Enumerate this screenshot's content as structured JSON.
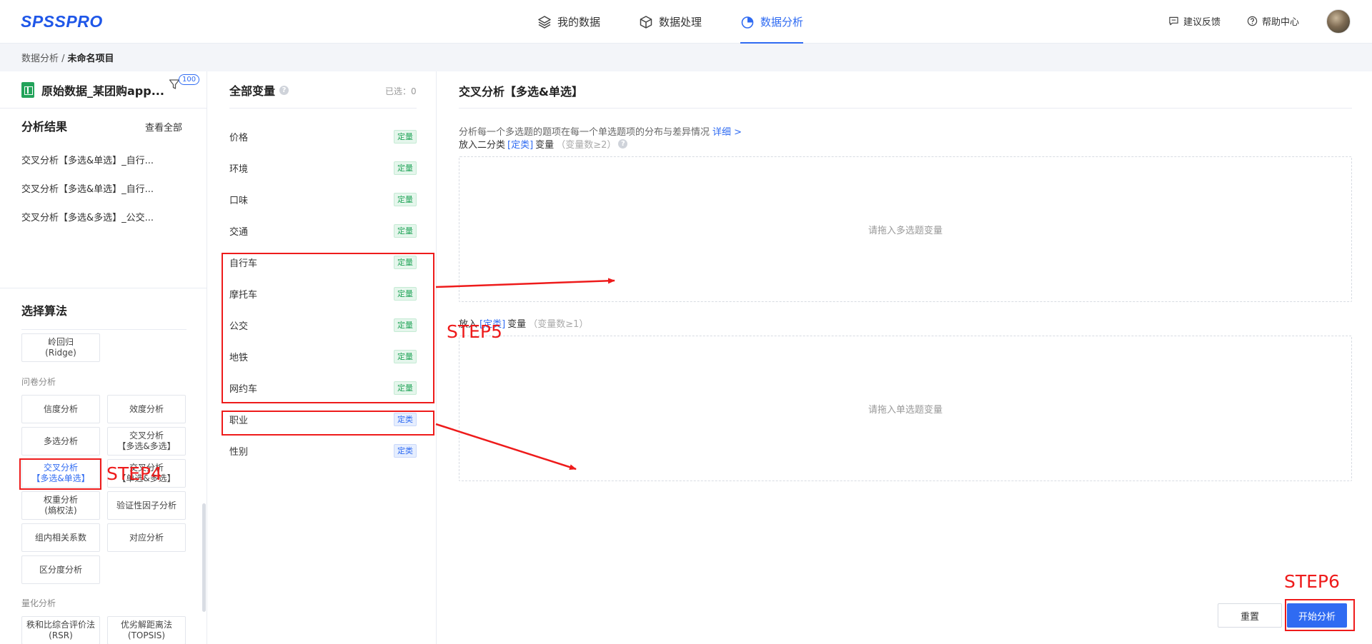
{
  "app": {
    "logo": "SPSSPRO"
  },
  "nav": {
    "tabs": [
      {
        "label": "我的数据",
        "icon": "layers-icon"
      },
      {
        "label": "数据处理",
        "icon": "cube-icon"
      },
      {
        "label": "数据分析",
        "icon": "pie-chart-icon",
        "active": true
      }
    ],
    "feedback": "建议反馈",
    "help": "帮助中心"
  },
  "breadcrumb": {
    "parent": "数据分析 /",
    "current": "未命名项目"
  },
  "left": {
    "dataset_name": "原始数据_某团购app...",
    "filter_badge": "100",
    "results_title": "分析结果",
    "results_view_all": "查看全部",
    "results": [
      "交叉分析【多选&单选】_自行...",
      "交叉分析【多选&单选】_自行...",
      "交叉分析【多选&多选】_公交..."
    ],
    "algo_title": "选择算法",
    "ridge": "岭回归\n(Ridge)",
    "group_questionnaire": "问卷分析",
    "algos": [
      "信度分析",
      "效度分析",
      "多选分析",
      "交叉分析\n【多选&多选】",
      "交叉分析\n【多选&单选】",
      "交叉分析\n【单选&多选】",
      "权重分析\n(熵权法)",
      "验证性因子分析",
      "组内相关系数",
      "对应分析",
      "区分度分析"
    ],
    "group_quant": "量化分析",
    "quant_algos": [
      "秩和比综合评价法\n(RSR)",
      "优劣解距离法\n(TOPSIS)"
    ]
  },
  "variables": {
    "title": "全部变量",
    "selected": "已选：0",
    "items": [
      {
        "name": "价格",
        "type": "定量"
      },
      {
        "name": "环境",
        "type": "定量"
      },
      {
        "name": "口味",
        "type": "定量"
      },
      {
        "name": "交通",
        "type": "定量"
      },
      {
        "name": "自行车",
        "type": "定量"
      },
      {
        "name": "摩托车",
        "type": "定量"
      },
      {
        "name": "公交",
        "type": "定量"
      },
      {
        "name": "地铁",
        "type": "定量"
      },
      {
        "name": "网约车",
        "type": "定量"
      },
      {
        "name": "职业",
        "type": "定类"
      },
      {
        "name": "性别",
        "type": "定类"
      }
    ]
  },
  "analysis": {
    "title": "交叉分析【多选&单选】",
    "description": "分析每一个多选题的题项在每一个单选题项的分布与差异情况",
    "detail_link": "详细 >",
    "zone1": {
      "prefix": "放入二分类",
      "kind": "[定类]",
      "suffix": "变量",
      "requirement": "（变量数≥2）",
      "placeholder": "请拖入多选题变量"
    },
    "zone2": {
      "prefix": "放入",
      "kind": "[定类]",
      "suffix": "变量",
      "requirement": "（变量数≥1）",
      "placeholder": "请拖入单选题变量"
    },
    "reset": "重置",
    "start": "开始分析"
  },
  "annotations": {
    "step4": "STEP4",
    "step5": "STEP5",
    "step6": "STEP6",
    "color": "#ee1b1b"
  }
}
